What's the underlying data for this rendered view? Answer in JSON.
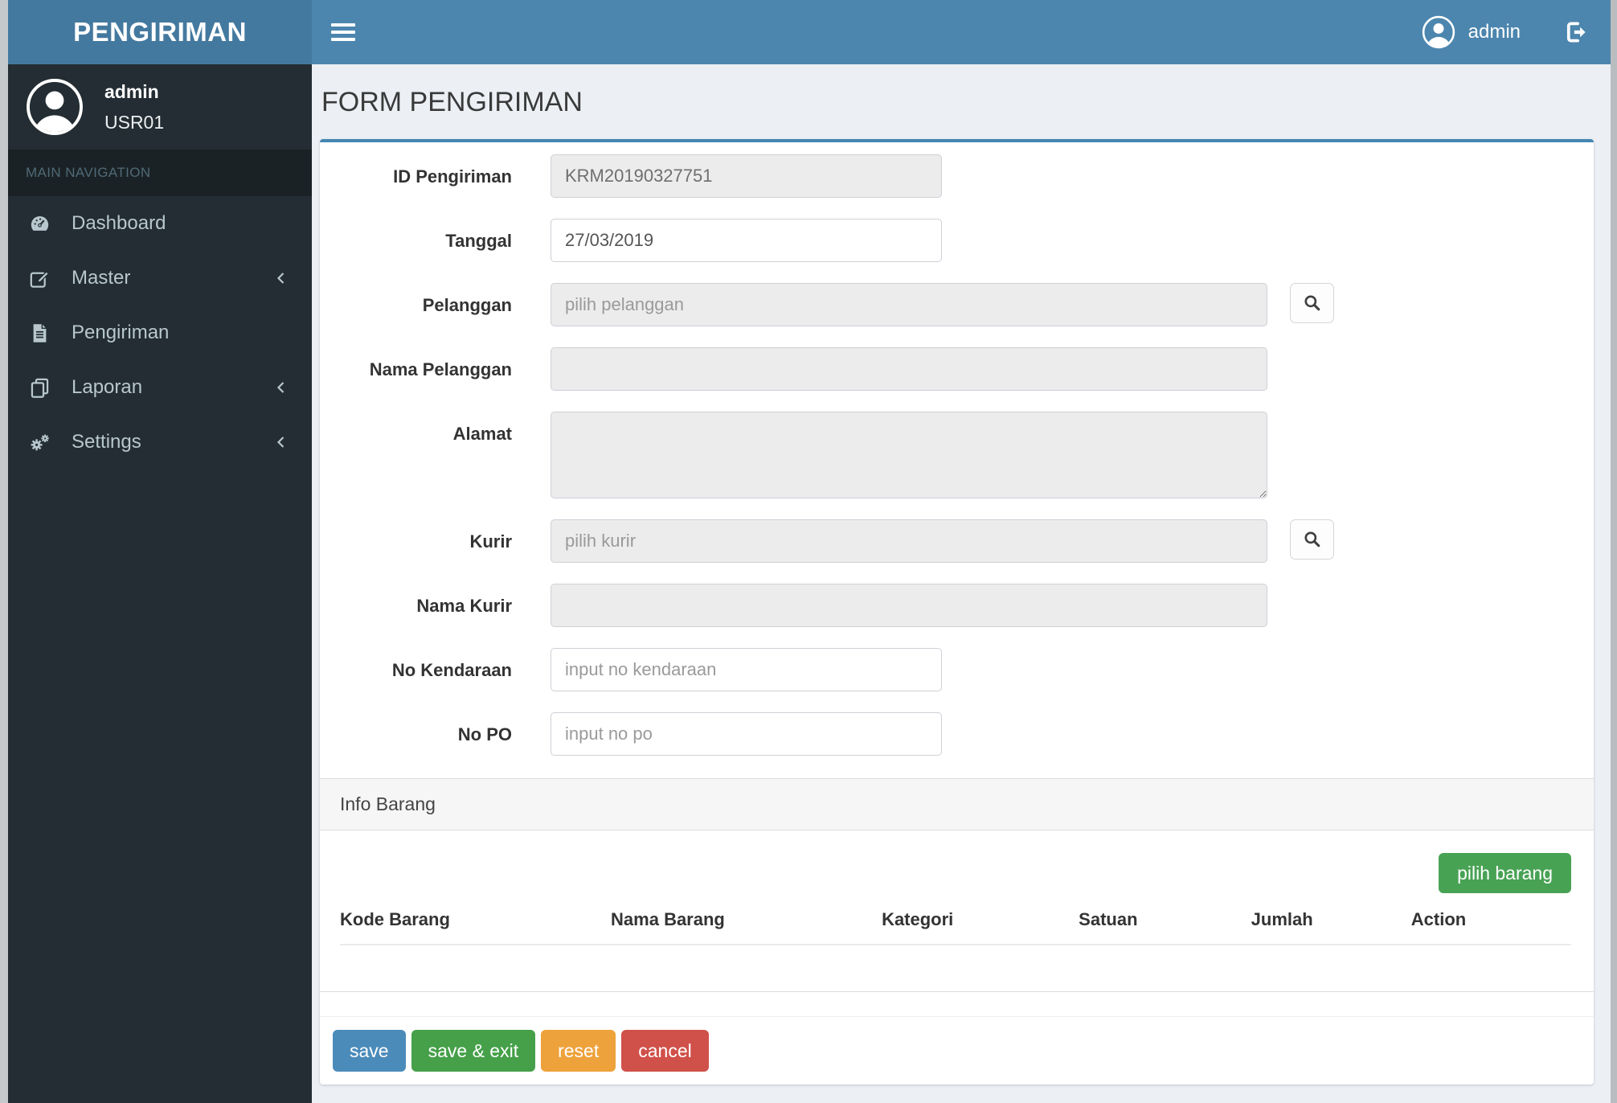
{
  "brand": "PENGIRIMAN",
  "colors": {
    "navbar_bg": "#4c86ae",
    "brand_bg": "#44799f",
    "sidebar_bg": "#232d33",
    "sidebar_section_bg": "#1a2226",
    "content_bg": "#ecf0f5",
    "box_top_border": "#4586b2",
    "primary": "#4b8bba",
    "success": "#45a049",
    "warning": "#eea23b",
    "danger": "#d0514a"
  },
  "navbar": {
    "username": "admin"
  },
  "sidebar": {
    "username": "admin",
    "user_id": "USR01",
    "section_header": "MAIN NAVIGATION",
    "items": [
      {
        "label": "Dashboard",
        "icon": "gauge-icon",
        "has_submenu": false
      },
      {
        "label": "Master",
        "icon": "edit-icon",
        "has_submenu": true
      },
      {
        "label": "Pengiriman",
        "icon": "document-icon",
        "has_submenu": false
      },
      {
        "label": "Laporan",
        "icon": "copy-icon",
        "has_submenu": true
      },
      {
        "label": "Settings",
        "icon": "gears-icon",
        "has_submenu": true
      }
    ]
  },
  "page": {
    "title": "FORM PENGIRIMAN"
  },
  "form": {
    "fields": [
      {
        "label": "ID Pengiriman",
        "value": "KRM20190327751"
      },
      {
        "label": "Tanggal",
        "value": "27/03/2019"
      },
      {
        "label": "Pelanggan",
        "placeholder": "pilih pelanggan"
      },
      {
        "label": "Nama Pelanggan",
        "value": ""
      },
      {
        "label": "Alamat",
        "value": ""
      },
      {
        "label": "Kurir",
        "placeholder": "pilih kurir"
      },
      {
        "label": "Nama Kurir",
        "value": ""
      },
      {
        "label": "No Kendaraan",
        "placeholder": "input no kendaraan"
      },
      {
        "label": "No PO",
        "placeholder": "input no po"
      }
    ]
  },
  "info_box": {
    "title": "Info Barang",
    "pick_button": "pilih barang",
    "columns": [
      "Kode Barang",
      "Nama Barang",
      "Kategori",
      "Satuan",
      "Jumlah",
      "Action"
    ],
    "rows": []
  },
  "footer_buttons": {
    "save": "save",
    "save_exit": "save & exit",
    "reset": "reset",
    "cancel": "cancel"
  }
}
